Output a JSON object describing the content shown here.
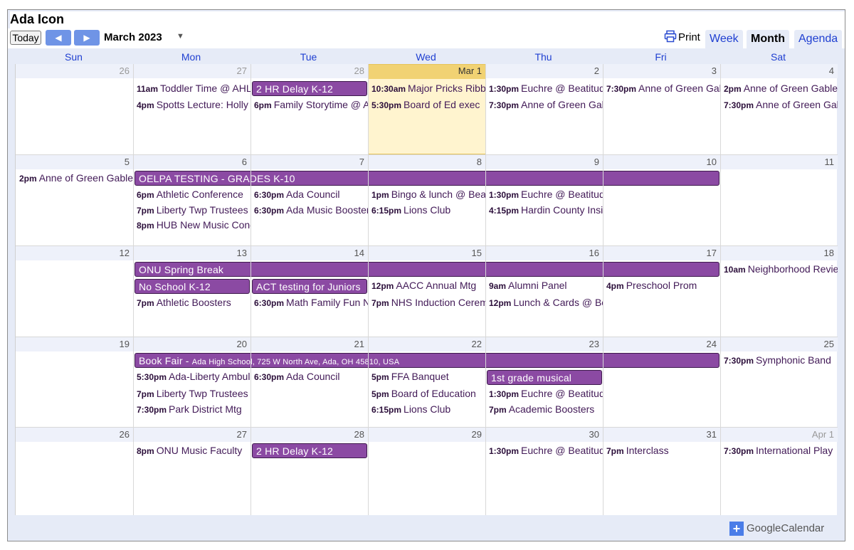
{
  "app_title": "Ada Icon",
  "toolbar": {
    "today_label": "Today",
    "prev_icon": "◀",
    "next_icon": "▶",
    "month_label": "March 2023",
    "dropdown_icon": "▼",
    "print_label": "Print"
  },
  "views": {
    "week": "Week",
    "month": "Month",
    "agenda": "Agenda"
  },
  "weekdays": [
    "Sun",
    "Mon",
    "Tue",
    "Wed",
    "Thu",
    "Fri",
    "Sat"
  ],
  "weeks": [
    {
      "days": [
        "26",
        "27",
        "28",
        "Mar 1",
        "2",
        "3",
        "4"
      ],
      "bars": [
        {
          "text": "2 HR Delay K-12"
        }
      ],
      "events": [
        {
          "time": "11am",
          "title": "Toddler Time @ AHL"
        },
        {
          "time": "4pm",
          "title": "Spotts Lecture: Holly"
        },
        {
          "time": "6pm",
          "title": "Family Storytime @ AHL"
        },
        {
          "time": "10:30am",
          "title": "Major Pricks Ribbon"
        },
        {
          "time": "5:30pm",
          "title": "Board of Ed exec"
        },
        {
          "time": "1:30pm",
          "title": "Euchre @ Beatitudes"
        },
        {
          "time": "7:30pm",
          "title": "Anne of Green Gables"
        },
        {
          "time": "7:30pm",
          "title": "Anne of Green Gables"
        },
        {
          "time": "2pm",
          "title": "Anne of Green Gables"
        },
        {
          "time": "7:30pm",
          "title": "Anne of Green Gables"
        }
      ]
    },
    {
      "days": [
        "5",
        "6",
        "7",
        "8",
        "9",
        "10",
        "11"
      ],
      "bars": [
        {
          "text": "OELPA TESTING - GRADES K-10"
        }
      ],
      "events": [
        {
          "time": "2pm",
          "title": "Anne of Green Gables"
        },
        {
          "time": "6pm",
          "title": "Athletic Conference"
        },
        {
          "time": "7pm",
          "title": "Liberty Twp Trustees"
        },
        {
          "time": "8pm",
          "title": "HUB New Music Concert"
        },
        {
          "time": "6:30pm",
          "title": "Ada Council"
        },
        {
          "time": "6:30pm",
          "title": "Ada Music Boosters"
        },
        {
          "time": "1pm",
          "title": "Bingo & lunch @ Beatitudes"
        },
        {
          "time": "6:15pm",
          "title": "Lions Club"
        },
        {
          "time": "1:30pm",
          "title": "Euchre @ Beatitudes"
        },
        {
          "time": "4:15pm",
          "title": "Hardin County Insight"
        }
      ]
    },
    {
      "days": [
        "12",
        "13",
        "14",
        "15",
        "16",
        "17",
        "18"
      ],
      "bars": [
        {
          "text": "ONU Spring Break"
        },
        {
          "text": "No School K-12"
        },
        {
          "text": "ACT testing for Juniors"
        }
      ],
      "events": [
        {
          "time": "7pm",
          "title": "Athletic Boosters"
        },
        {
          "time": "6:30pm",
          "title": "Math Family Fun Night"
        },
        {
          "time": "12pm",
          "title": "AACC Annual Mtg"
        },
        {
          "time": "7pm",
          "title": "NHS Induction Ceremony"
        },
        {
          "time": "9am",
          "title": "Alumni Panel"
        },
        {
          "time": "12pm",
          "title": "Lunch & Cards @ Beatitudes"
        },
        {
          "time": "4pm",
          "title": "Preschool Prom"
        },
        {
          "time": "10am",
          "title": "Neighborhood Review"
        }
      ]
    },
    {
      "days": [
        "19",
        "20",
        "21",
        "22",
        "23",
        "24",
        "25"
      ],
      "bars": [
        {
          "text": "Book Fair - ",
          "small": "Ada High School, 725 W North Ave, Ada, OH 45810, USA"
        },
        {
          "text": "1st grade musical"
        }
      ],
      "events": [
        {
          "time": "5:30pm",
          "title": "Ada-Liberty Ambulance"
        },
        {
          "time": "7pm",
          "title": "Liberty Twp Trustees"
        },
        {
          "time": "7:30pm",
          "title": "Park District Mtg"
        },
        {
          "time": "6:30pm",
          "title": "Ada Council"
        },
        {
          "time": "5pm",
          "title": "FFA Banquet"
        },
        {
          "time": "5pm",
          "title": "Board of Education"
        },
        {
          "time": "6:15pm",
          "title": "Lions Club"
        },
        {
          "time": "1:30pm",
          "title": "Euchre @ Beatitudes"
        },
        {
          "time": "7pm",
          "title": "Academic Boosters"
        },
        {
          "time": "7:30pm",
          "title": "Symphonic Band"
        }
      ]
    },
    {
      "days": [
        "26",
        "27",
        "28",
        "29",
        "30",
        "31",
        "Apr 1"
      ],
      "bars": [
        {
          "text": "2 HR Delay K-12"
        }
      ],
      "events": [
        {
          "time": "8pm",
          "title": "ONU Music Faculty"
        },
        {
          "time": "1:30pm",
          "title": "Euchre @ Beatitudes"
        },
        {
          "time": "7pm",
          "title": "Interclass"
        },
        {
          "time": "7:30pm",
          "title": "International Play"
        }
      ]
    }
  ],
  "footer": {
    "google": "Google",
    "calendar": "Calendar"
  },
  "colors": {
    "event_bar": "#8b4aa3",
    "today_bg": "#fff4cf",
    "today_header": "#f1d273",
    "link": "#1f3fd1"
  }
}
